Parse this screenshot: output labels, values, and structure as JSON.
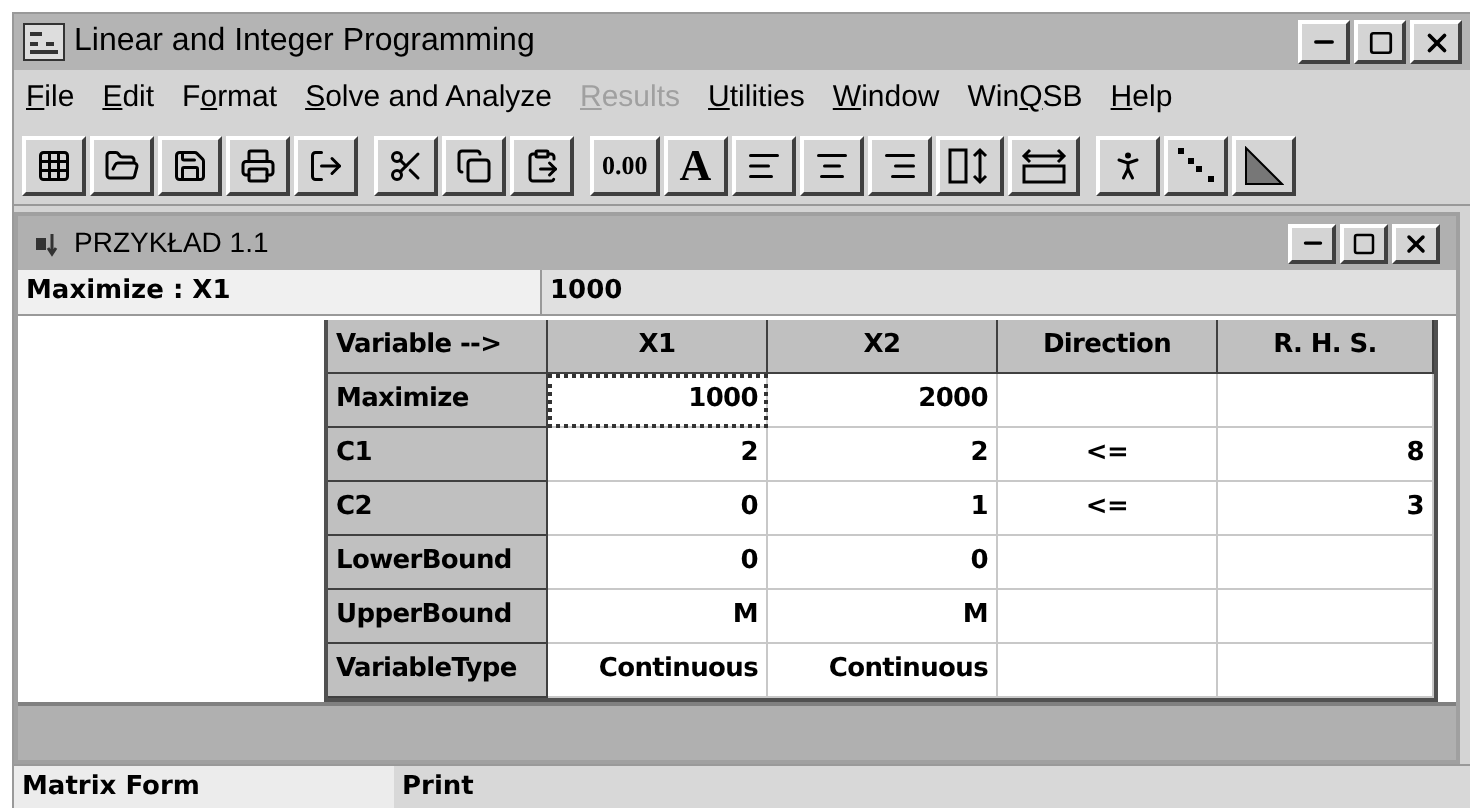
{
  "window": {
    "title": "Linear and Integer Programming"
  },
  "menu": [
    {
      "key": "F",
      "post": "ile",
      "disabled": false
    },
    {
      "key": "E",
      "post": "dit",
      "disabled": false
    },
    {
      "pre": "F",
      "key": "o",
      "post": "rmat",
      "disabled": false
    },
    {
      "key": "S",
      "post": "olve and Analyze",
      "disabled": false
    },
    {
      "key": "R",
      "post": "esults",
      "disabled": true
    },
    {
      "key": "U",
      "post": "tilities",
      "disabled": false
    },
    {
      "key": "W",
      "post": "indow",
      "disabled": false
    },
    {
      "pre": "Win",
      "key": "Q",
      "post": "SB",
      "disabled": false
    },
    {
      "key": "H",
      "post": "elp",
      "disabled": false
    }
  ],
  "toolbar": [
    [
      {
        "kind": "icon"
      },
      {
        "kind": "icon"
      },
      {
        "kind": "icon"
      },
      {
        "kind": "icon"
      },
      {
        "kind": "icon"
      }
    ],
    [
      {
        "kind": "icon"
      },
      {
        "kind": "icon"
      },
      {
        "kind": "icon"
      }
    ],
    [
      {
        "kind": "text",
        "label": "0.00"
      },
      {
        "kind": "text",
        "label": "A"
      },
      {
        "kind": "icon"
      },
      {
        "kind": "icon"
      },
      {
        "kind": "icon"
      },
      {
        "kind": "icon"
      },
      {
        "kind": "icon"
      }
    ],
    [
      {
        "kind": "icon"
      },
      {
        "kind": "icon"
      },
      {
        "kind": "icon"
      }
    ]
  ],
  "document": {
    "title": "PRZYKŁAD 1.1",
    "formula_bar": {
      "cell": "Maximize : X1",
      "value": "1000"
    },
    "table": {
      "corner": "Variable -->",
      "columns": [
        "X1",
        "X2",
        "Direction",
        "R. H. S."
      ],
      "rows": [
        {
          "label": "Maximize",
          "cells": [
            {
              "text": "1000",
              "selected": true
            },
            {
              "text": "2000",
              "selected": false
            },
            {
              "selected": false
            },
            {
              "selected": false
            }
          ]
        },
        {
          "label": "C1",
          "cells": [
            {
              "text": "2",
              "selected": false
            },
            {
              "text": "2",
              "selected": false
            },
            {
              "text": "<=",
              "selected": false
            },
            {
              "text": "8",
              "selected": false
            }
          ]
        },
        {
          "label": "C2",
          "cells": [
            {
              "text": "0",
              "selected": false
            },
            {
              "text": "1",
              "selected": false
            },
            {
              "text": "<=",
              "selected": false
            },
            {
              "text": "3",
              "selected": false
            }
          ]
        },
        {
          "label": "LowerBound",
          "cells": [
            {
              "text": "0",
              "selected": false
            },
            {
              "text": "0",
              "selected": false
            },
            {
              "selected": false
            },
            {
              "selected": false
            }
          ]
        },
        {
          "label": "UpperBound",
          "cells": [
            {
              "text": "M",
              "selected": false
            },
            {
              "text": "M",
              "selected": false
            },
            {
              "selected": false
            },
            {
              "selected": false
            }
          ]
        },
        {
          "label": "VariableType",
          "cells": [
            {
              "text": "Continuous",
              "selected": false
            },
            {
              "text": "Continuous",
              "selected": false
            },
            {
              "selected": false
            },
            {
              "selected": false
            }
          ]
        }
      ]
    }
  },
  "status_bar": [
    "Matrix Form",
    "Print"
  ]
}
